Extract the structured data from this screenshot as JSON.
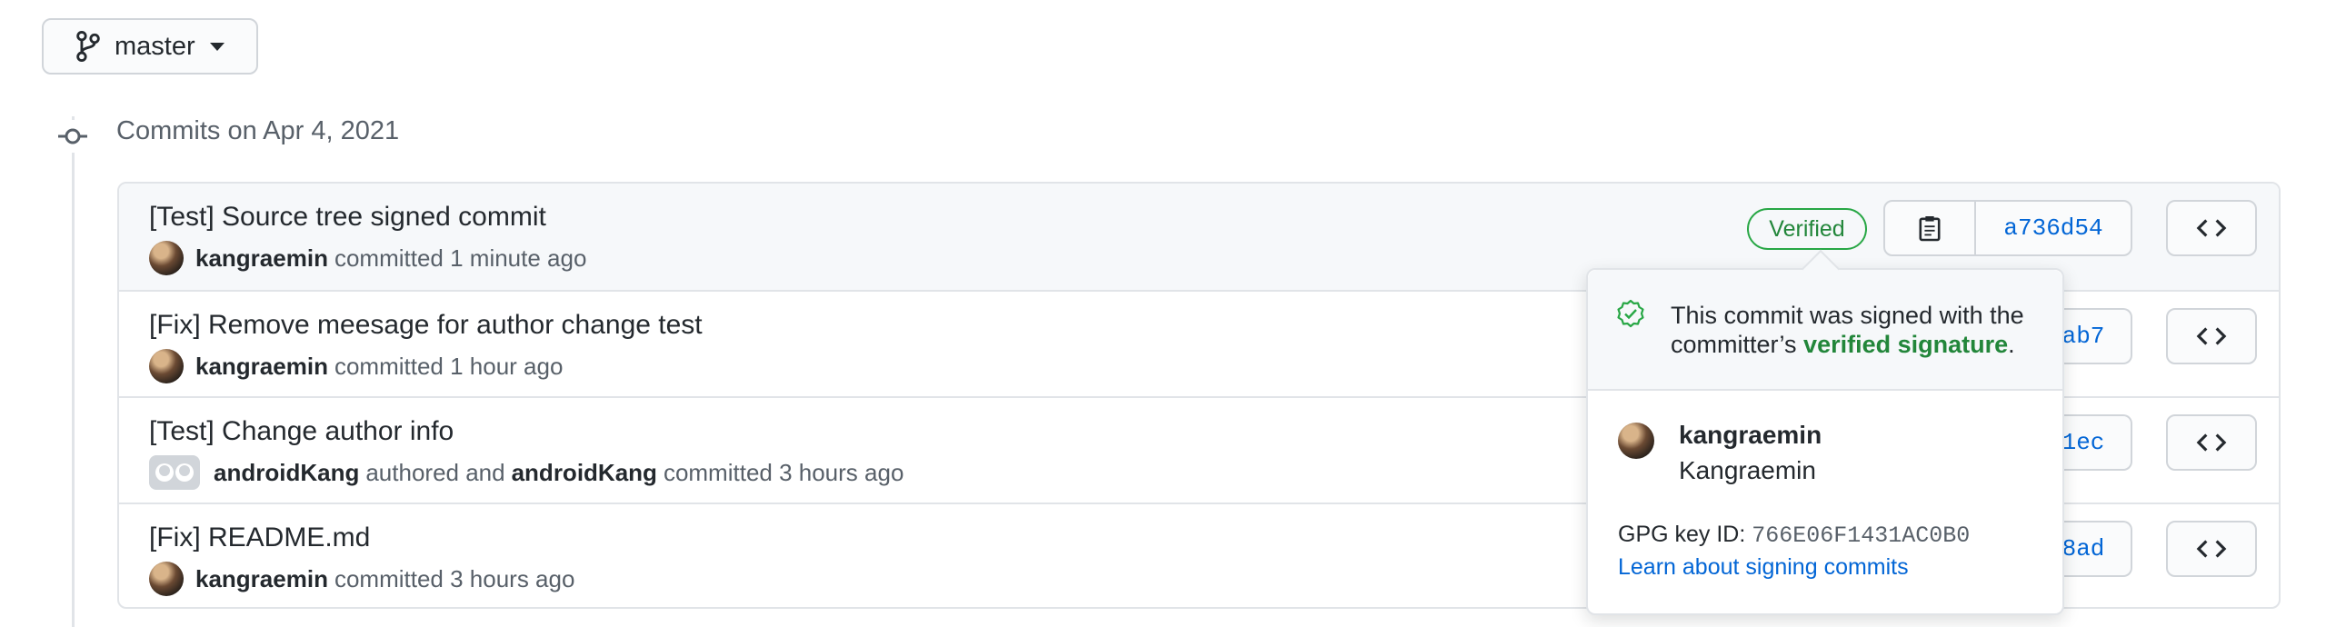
{
  "branch": {
    "label": "master",
    "icon": "git-branch-icon"
  },
  "group": {
    "title": "Commits on Apr 4, 2021",
    "icon": "git-commit-icon"
  },
  "commits": [
    {
      "title": "[Test] Source tree signed commit",
      "author": "kangraemin",
      "meta": "committed 1 minute ago",
      "sha": "a736d54",
      "verified": "Verified"
    },
    {
      "title": "[Fix] Remove meesage for author change test",
      "author": "kangraemin",
      "meta": "committed 1 hour ago",
      "sha_visible": "cab7"
    },
    {
      "title": "[Test] Change author info",
      "author": "androidKang",
      "mid": "authored and",
      "author2": "androidKang",
      "meta": "committed 3 hours ago",
      "sha_visible": "51ec"
    },
    {
      "title": "[Fix] README.md",
      "author": "kangraemin",
      "meta": "committed 3 hours ago",
      "sha_visible": "18ad"
    }
  ],
  "popover": {
    "message_pre": "This commit was signed with the committer’s",
    "message_link": "verified signature",
    "message_post": ".",
    "login": "kangraemin",
    "name": "Kangraemin",
    "gpg_label": "GPG key ID:",
    "gpg_key": "766E06F1431AC0B0",
    "learn_link": "Learn about signing commits"
  },
  "colors": {
    "link": "#0366d6",
    "verified": "#22863a",
    "border": "#e1e4e8",
    "muted": "#586069"
  }
}
